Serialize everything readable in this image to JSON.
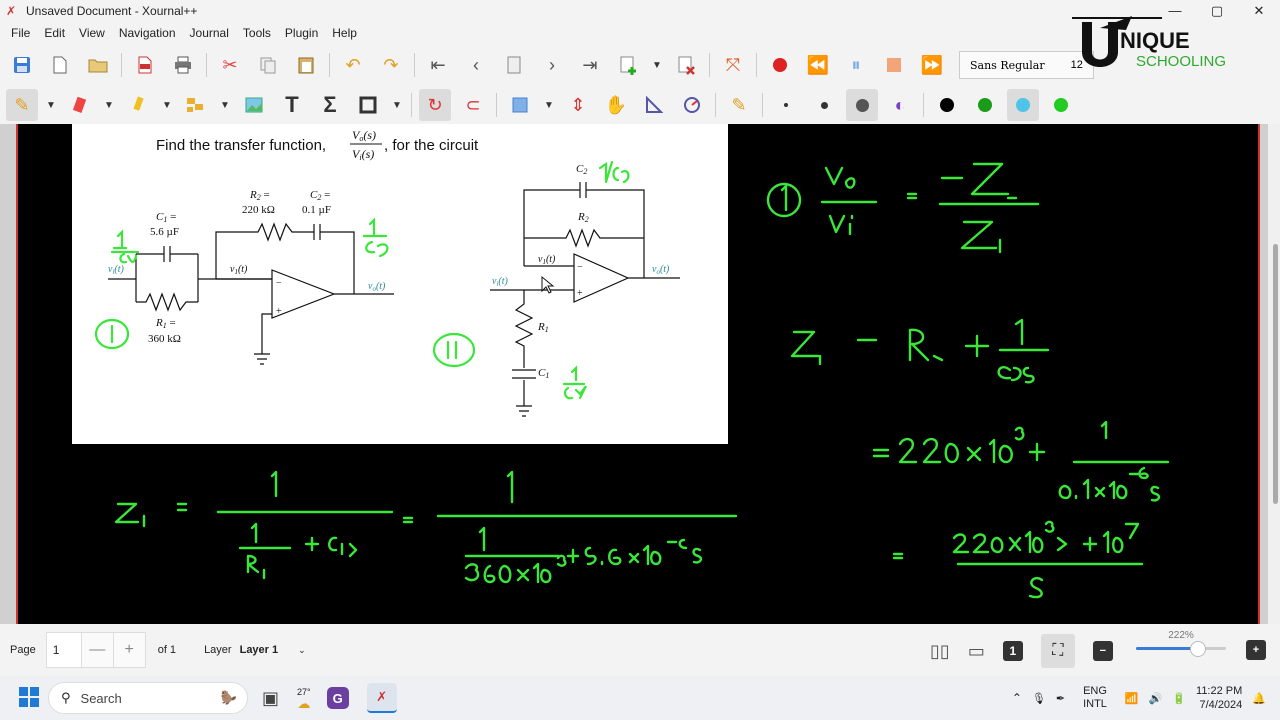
{
  "window": {
    "title": "Unsaved Document - Xournal++",
    "controls": [
      "—",
      "▢",
      "✕"
    ]
  },
  "menu": [
    "File",
    "Edit",
    "View",
    "Navigation",
    "Journal",
    "Tools",
    "Plugin",
    "Help"
  ],
  "toolbar": {
    "font_name": "Sans Regular",
    "font_size": "12"
  },
  "colors": {
    "palette": [
      "#000000",
      "#1a9b1a",
      "#4fc3e8",
      "#22cc22"
    ],
    "ink": "#39e639",
    "selected_tool": "#dcdcdc"
  },
  "logo": {
    "text_top": "NIQUE",
    "text_bottom": "SCHOOLING"
  },
  "problem": {
    "prompt_prefix": "Find the transfer function,",
    "num": "V",
    "num_sub": "o",
    "num_arg": "(s)",
    "den": "V",
    "den_sub": "i",
    "den_arg": "(s)",
    "prompt_suffix": ", for the circuit"
  },
  "circuit1": {
    "c1_label": "C",
    "c1_sub": "1",
    "c1_eq": " =",
    "c1_value": "5.6 µF",
    "r1_label": "R",
    "r1_sub": "1",
    "r1_eq": " =",
    "r1_value": "360 kΩ",
    "r2_label": "R",
    "r2_sub": "2",
    "r2_eq": " =",
    "r2_value": "220 kΩ",
    "c2_label": "C",
    "c2_sub": "2",
    "c2_eq": " =",
    "c2_value": "0.1 µF",
    "vi": "v",
    "vi_sub": "i",
    "vi_arg": "(t)",
    "v1": "v",
    "v1_sub": "1",
    "v1_arg": "(t)",
    "vo": "v",
    "vo_sub": "o",
    "vo_arg": "(t)"
  },
  "circuit2": {
    "c2_label": "C",
    "c2_sub": "2",
    "r2_label": "R",
    "r2_sub": "2",
    "v1": "v",
    "v1_sub": "1",
    "v1_arg": "(t)",
    "vi": "v",
    "vi_sub": "i",
    "vi_arg": "(t)",
    "vo": "v",
    "vo_sub": "o",
    "vo_arg": "(t)",
    "r1_label": "R",
    "r1_sub": "1",
    "c1_label": "C",
    "c1_sub": "1"
  },
  "status": {
    "page_label": "Page",
    "page_value": "1",
    "of_label": "of 1",
    "layer_label": "Layer",
    "layer_value": "Layer 1",
    "zoom": "222%"
  },
  "taskbar": {
    "search": "Search",
    "weather": "27°",
    "lang_top": "ENG",
    "lang_bottom": "INTL",
    "time": "11:22 PM",
    "date": "7/4/2024"
  }
}
